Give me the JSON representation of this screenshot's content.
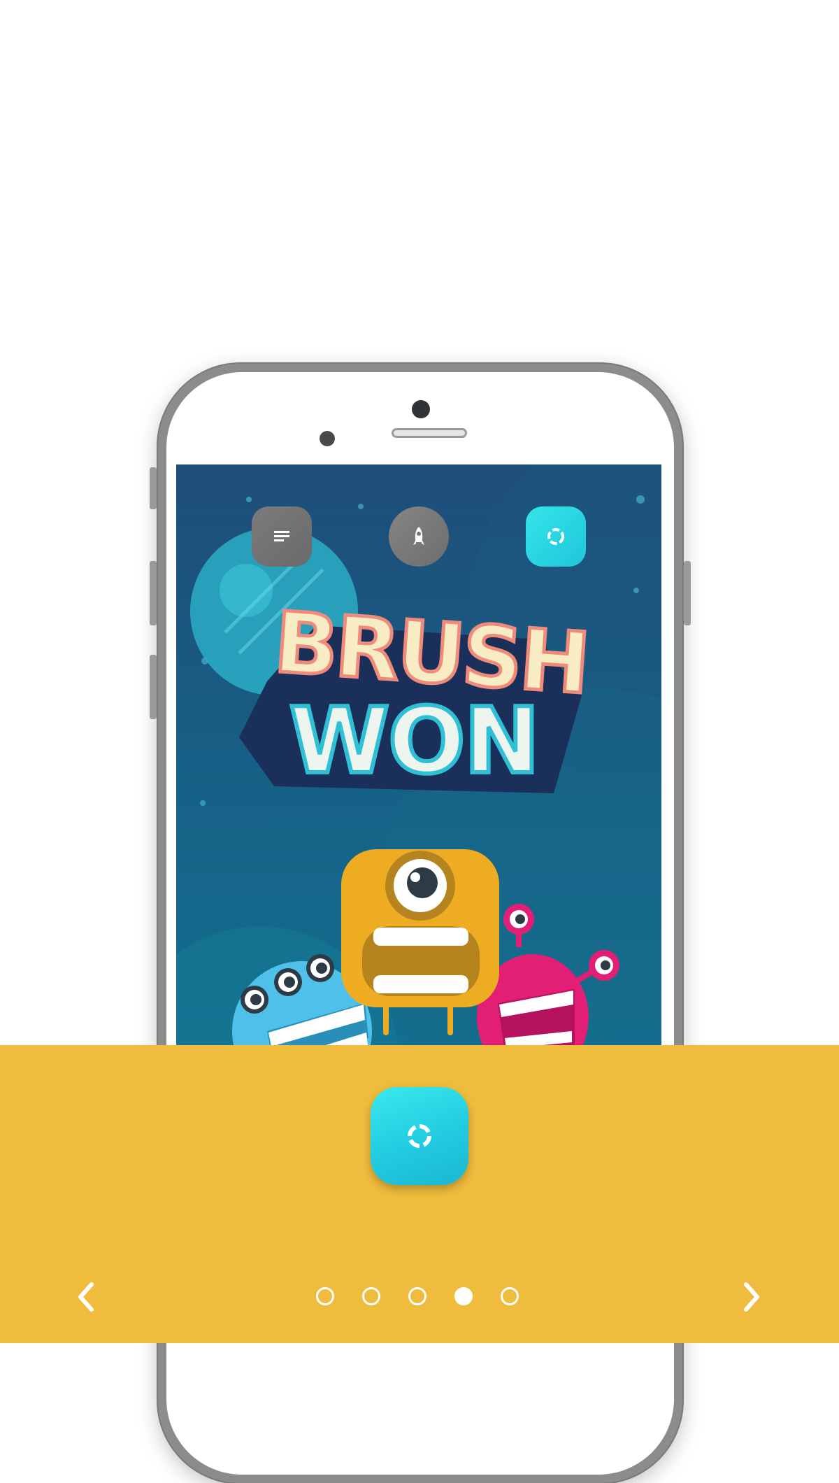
{
  "game": {
    "title_line1": "BRUSH",
    "title_line2": "WON"
  },
  "game_buttons": [
    {
      "icon": "menu-icon"
    },
    {
      "icon": "rocket-icon"
    },
    {
      "icon": "loading-icon"
    }
  ],
  "feature": {
    "icon": "loading-circle-icon",
    "accent_color": "#22cbe0"
  },
  "panel": {
    "background_color": "#efbc3d"
  },
  "pagination": {
    "total": 5,
    "active_index": 3
  },
  "navigation": {
    "prev_icon": "chevron-left-icon",
    "next_icon": "chevron-right-icon"
  }
}
